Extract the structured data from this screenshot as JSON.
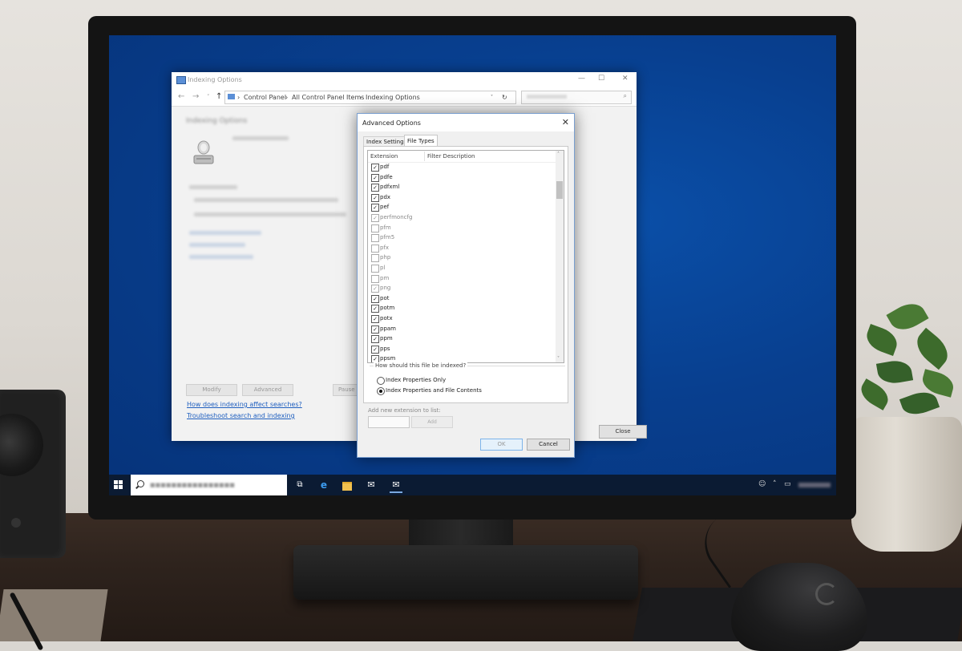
{
  "indexing_window": {
    "title": "Indexing Options",
    "breadcrumb": [
      "Control Panel",
      "All Control Panel Items",
      "Indexing Options"
    ],
    "heading": "Indexing Options",
    "modify_label": "Modify",
    "advanced_label": "Advanced",
    "pause_label": "Pause",
    "link_how": "How does indexing affect searches?",
    "link_troubleshoot": "Troubleshoot search and indexing",
    "close_label": "Close"
  },
  "dialog": {
    "title": "Advanced Options",
    "tabs": [
      {
        "label": "Index Settings",
        "active": false
      },
      {
        "label": "File Types",
        "active": true
      }
    ],
    "columns": [
      "Extension",
      "Filter Description"
    ],
    "extensions": [
      {
        "ext": "pdf",
        "checked": true,
        "dim": false
      },
      {
        "ext": "pdfe",
        "checked": true,
        "dim": false
      },
      {
        "ext": "pdfxml",
        "checked": true,
        "dim": false
      },
      {
        "ext": "pdx",
        "checked": true,
        "dim": false
      },
      {
        "ext": "pef",
        "checked": true,
        "dim": false
      },
      {
        "ext": "perfmoncfg",
        "checked": true,
        "dim": true
      },
      {
        "ext": "pfm",
        "checked": false,
        "dim": true
      },
      {
        "ext": "pfm5",
        "checked": false,
        "dim": true
      },
      {
        "ext": "pfx",
        "checked": false,
        "dim": true
      },
      {
        "ext": "php",
        "checked": false,
        "dim": true
      },
      {
        "ext": "pl",
        "checked": false,
        "dim": true
      },
      {
        "ext": "pm",
        "checked": false,
        "dim": true
      },
      {
        "ext": "png",
        "checked": true,
        "dim": true
      },
      {
        "ext": "pot",
        "checked": true,
        "dim": false
      },
      {
        "ext": "potm",
        "checked": true,
        "dim": false
      },
      {
        "ext": "potx",
        "checked": true,
        "dim": false
      },
      {
        "ext": "ppam",
        "checked": true,
        "dim": false
      },
      {
        "ext": "ppm",
        "checked": true,
        "dim": false
      },
      {
        "ext": "pps",
        "checked": true,
        "dim": false
      },
      {
        "ext": "ppsm",
        "checked": true,
        "dim": false
      }
    ],
    "group_label": "How should this file be indexed?",
    "option_properties_only": "Index Properties Only",
    "option_properties_contents": "Index Properties and File Contents",
    "selected_option": "Index Properties and File Contents",
    "add_label": "Add new extension to list:",
    "add_button": "Add",
    "ok_label": "OK",
    "cancel_label": "Cancel"
  },
  "colors": {
    "desktop": "#083f8f",
    "taskbar": "#0b1b33",
    "link": "#1f5fbf",
    "ok_border": "#7eb4ea"
  },
  "taskbar": {
    "icons": [
      "windows-start-icon",
      "search-icon",
      "task-view-icon",
      "edge-icon",
      "file-explorer-icon",
      "mail-icon",
      "mail-icon"
    ]
  }
}
